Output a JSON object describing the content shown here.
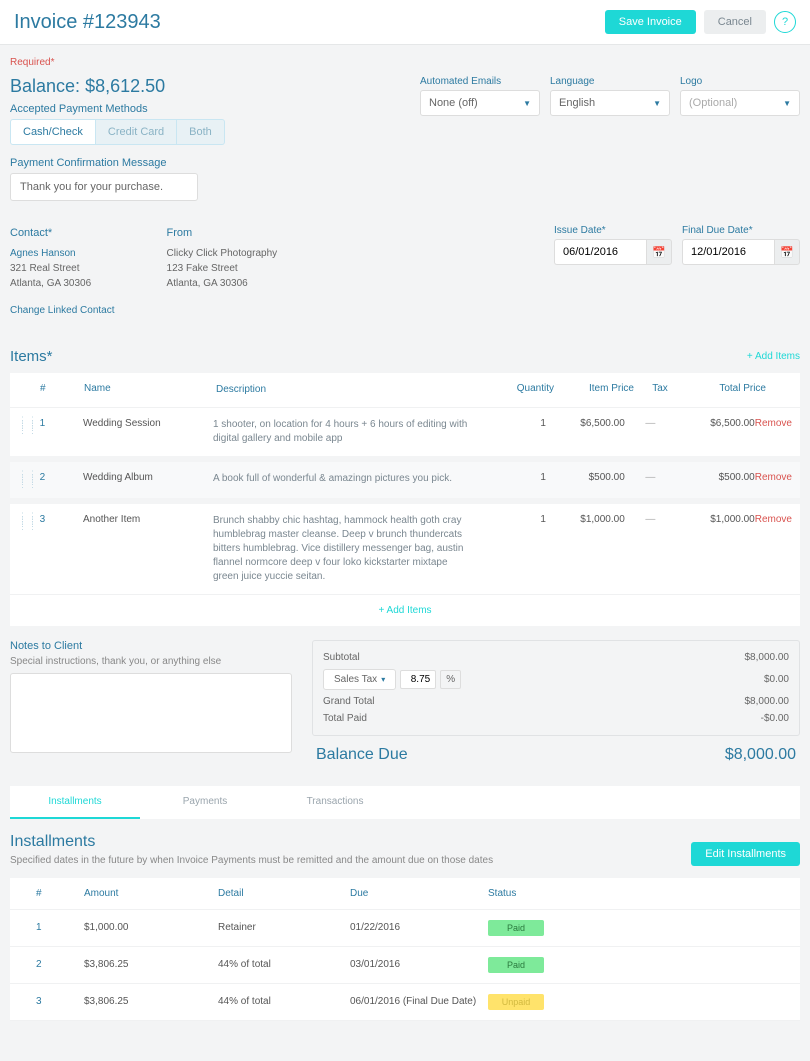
{
  "header": {
    "title": "Invoice #123943",
    "save": "Save Invoice",
    "cancel": "Cancel",
    "help": "?"
  },
  "required": "Required*",
  "balance_label": "Balance: ",
  "balance_value": "$8,612.50",
  "accepted_label": "Accepted Payment Methods",
  "pay_methods": [
    "Cash/Check",
    "Credit Card",
    "Both"
  ],
  "selects": {
    "auto_emails": {
      "label": "Automated Emails",
      "value": "None (off)"
    },
    "language": {
      "label": "Language",
      "value": "English"
    },
    "logo": {
      "label": "Logo",
      "value": "(Optional)"
    }
  },
  "confirmation": {
    "label": "Payment Confirmation Message",
    "value": "Thank you for your purchase."
  },
  "contact": {
    "label": "Contact*",
    "name": "Agnes Hanson",
    "street": "321 Real Street",
    "city": "Atlanta, GA 30306",
    "change": "Change Linked Contact"
  },
  "from": {
    "label": "From",
    "name": "Clicky Click Photography",
    "street": "123 Fake Street",
    "city": "Atlanta, GA 30306"
  },
  "dates": {
    "issue": {
      "label": "Issue Date*",
      "value": "06/01/2016"
    },
    "final": {
      "label": "Final Due Date*",
      "value": "12/01/2016"
    }
  },
  "items_section": {
    "title": "Items*",
    "add": "+ Add Items",
    "headers": {
      "num": "#",
      "name": "Name",
      "desc": "Description",
      "qty": "Quantity",
      "price": "Item Price",
      "tax": "Tax",
      "total": "Total Price"
    },
    "remove": "Remove",
    "dash": "—",
    "rows": [
      {
        "num": "1",
        "name": "Wedding Session",
        "desc": "1 shooter, on location for 4 hours + 6 hours of editing with digital gallery and mobile app",
        "qty": "1",
        "price": "$6,500.00",
        "total": "$6,500.00"
      },
      {
        "num": "2",
        "name": "Wedding Album",
        "desc": "A book full of wonderful & amazingn pictures you pick.",
        "qty": "1",
        "price": "$500.00",
        "total": "$500.00"
      },
      {
        "num": "3",
        "name": "Another Item",
        "desc": "Brunch shabby chic hashtag, hammock health goth cray humblebrag master cleanse. Deep v brunch thundercats bitters humblebrag. Vice distillery messenger bag, austin flannel normcore deep v four loko kickstarter mixtape green juice yuccie seitan.",
        "qty": "1",
        "price": "$1,000.00",
        "total": "$1,000.00"
      }
    ]
  },
  "notes": {
    "label": "Notes to Client",
    "hint": "Special instructions, thank you, or anything else"
  },
  "totals": {
    "subtotal_label": "Subtotal",
    "subtotal": "$8,000.00",
    "tax_label": "Sales Tax",
    "tax_rate": "8.75",
    "pct": "%",
    "tax_value": "$0.00",
    "grand_label": "Grand Total",
    "grand": "$8,000.00",
    "paid_label": "Total Paid",
    "paid": "-$0.00",
    "balance_due_label": "Balance Due",
    "balance_due": "$8,000.00"
  },
  "tabs": [
    "Installments",
    "Payments",
    "Transactions"
  ],
  "installments": {
    "title": "Installments",
    "desc": "Specified dates in the future by when Invoice Payments must be remitted and the amount due on those dates",
    "edit": "Edit Installments",
    "headers": {
      "num": "#",
      "amount": "Amount",
      "detail": "Detail",
      "due": "Due",
      "status": "Status"
    },
    "rows": [
      {
        "num": "1",
        "amount": "$1,000.00",
        "detail": "Retainer",
        "due": "01/22/2016",
        "status": "Paid",
        "status_class": "paid"
      },
      {
        "num": "2",
        "amount": "$3,806.25",
        "detail": "44% of total",
        "due": "03/01/2016",
        "status": "Paid",
        "status_class": "paid"
      },
      {
        "num": "3",
        "amount": "$3,806.25",
        "detail": "44% of total",
        "due": "06/01/2016 (Final Due Date)",
        "status": "Unpaid",
        "status_class": "unpaid"
      }
    ]
  }
}
